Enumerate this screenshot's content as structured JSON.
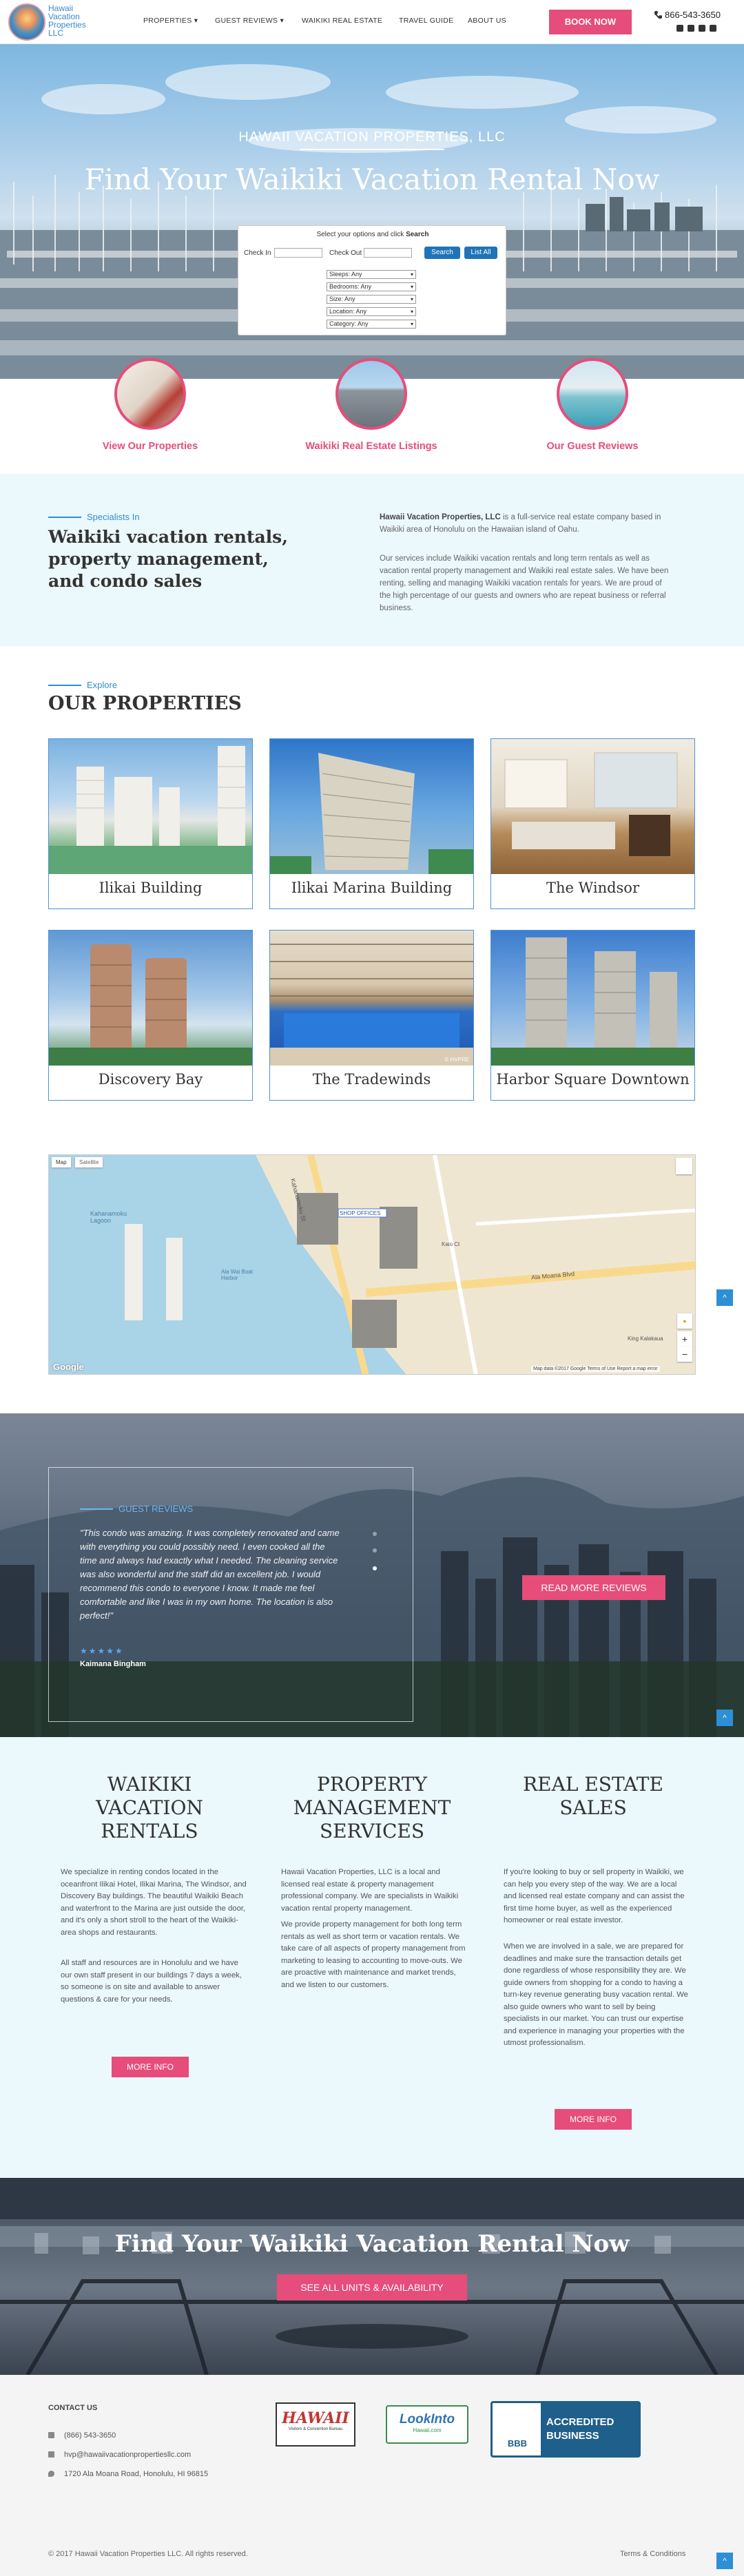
{
  "header": {
    "logo_text": "Hawaii Vacation Properties LLC",
    "nav": [
      "PROPERTIES",
      "GUEST REVIEWS",
      "WAIKIKI REAL ESTATE",
      "TRAVEL GUIDE",
      "ABOUT US"
    ],
    "book_label": "BOOK NOW",
    "phone": "866-543-3650",
    "accent_color": "#e64d7a",
    "brand_color": "#3b87c8"
  },
  "hero": {
    "subtitle": "HAWAII VACATION PROPERTIES, LLC",
    "title": "Find Your Waikiki Vacation Rental Now",
    "search": {
      "prompt": "Select your options and click ",
      "prompt_bold": "Search",
      "check_in_label": "Check In",
      "check_out_label": "Check Out",
      "search_button": "Search",
      "list_all_button": "List All",
      "selects": [
        "Sleeps: Any",
        "Bedrooms: Any",
        "Size: Any",
        "Location: Any",
        "Category: Any"
      ]
    }
  },
  "features": [
    {
      "label": "View Our Properties"
    },
    {
      "label": "Waikiki Real Estate Listings"
    },
    {
      "label": "Our Guest Reviews"
    }
  ],
  "specialists": {
    "eyebrow": "Specialists In",
    "heading": "Waikiki vacation rentals, property management, and condo sales",
    "p1_bold": "Hawaii Vacation Properties, LLC",
    "p1_rest": " is a full-service real estate company based in Waikiki area of Honolulu on the Hawaiian island of Oahu.",
    "p2": "Our services include Waikiki vacation rentals and long term rentals as well as vacation rental property management and Waikiki real estate sales. We have been renting, selling and managing Waikiki vacation rentals for years. We are proud of the high percentage of our guests and owners who are repeat business or referral business."
  },
  "properties": {
    "eyebrow": "Explore",
    "heading": "OUR PROPERTIES",
    "items": [
      {
        "name": "Ilikai Building"
      },
      {
        "name": "Ilikai Marina Building"
      },
      {
        "name": "The Windsor"
      },
      {
        "name": "Discovery Bay"
      },
      {
        "name": "The Tradewinds"
      },
      {
        "name": "Harbor Square Downtown"
      }
    ],
    "photo_credit": "© HVPRE"
  },
  "map": {
    "map_tab": "Map",
    "satellite_tab": "Satellite",
    "labels": [
      "Kahanamoku Lagoon",
      "Ala Wai Boat Harbor",
      "Ala Moana Blvd",
      "Kahanamoku St",
      "King Kalakaua",
      "Kaio Ct",
      "SHOP OFFICES"
    ],
    "google": "Google",
    "footer": "Map data ©2017 Google   Terms of Use   Report a map error"
  },
  "reviews": {
    "eyebrow": "GUEST REVIEWS",
    "quote": "\"This condo was amazing. It was completely renovated and came with everything you could possibly need. I even cooked all the time and always had exactly what I needed. The cleaning service was also wonderful and the staff did an excellent job. I would recommend this condo to everyone I know. It made me feel comfortable and like I was in my own home. The location is also perfect!\"",
    "stars": "★★★★★",
    "author": "Kaimana Bingham",
    "button": "READ MORE REVIEWS"
  },
  "services": [
    {
      "title": "WAIKIKI VACATION RENTALS",
      "paragraphs": [
        "We specialize in renting condos located in the oceanfront Ilikai Hotel, Ilikai Marina, The Windsor, and Discovery Bay buildings. The beautiful Waikiki Beach and waterfront to the Marina are just outside the door, and it's only a short stroll to the heart of the Waikiki-area shops and restaurants.",
        "All staff and resources are in Honolulu and we have our own staff present in our buildings 7 days a week, so someone is on site and available to answer questions & care for your needs."
      ],
      "button": "MORE INFO"
    },
    {
      "title": "PROPERTY MANAGEMENT SERVICES",
      "paragraphs": [
        "Hawaii Vacation Properties, LLC is a local and licensed real estate & property management professional company. We are specialists in Waikiki vacation rental property management.",
        "We provide property management for both long term rentals as well as short term or vacation rentals. We take care of all aspects of property management from marketing to leasing to accounting to move-outs. We are proactive with maintenance and market trends, and we listen to our customers."
      ],
      "button": ""
    },
    {
      "title": "REAL ESTATE SALES",
      "paragraphs": [
        "If you're looking to buy or sell property in Waikiki, we can help you every step of the way. We are a local and licensed real estate company and can assist the first time home buyer, as well as the experienced homeowner or real estate investor.",
        "When we are involved in a sale, we are prepared for deadlines and make sure the transaction details get done regardless of whose responsibility they are. We guide owners from shopping for a condo to having a turn-key revenue generating busy vacation rental. We also guide owners who want to sell by being specialists in our market. You can trust our expertise and experience in managing your properties with the utmost professionalism."
      ],
      "button": "MORE INFO"
    }
  ],
  "cta": {
    "title": "Find Your Waikiki Vacation Rental Now",
    "button": "SEE ALL UNITS & AVAILABILITY"
  },
  "footer": {
    "contact_heading": "CONTACT US",
    "phone": "(866) 543-3650",
    "email": "hvp@hawaiivacationpropertiesllc.com",
    "address": "1720 Ala Moana Road, Honolulu, HI 96815",
    "badge1": "HAWAII",
    "badge1_sub": "Visitors & Convention Bureau",
    "badge2": "LookInto",
    "badge2_sub": "Hawaii.com",
    "bbb": "BBB",
    "bbb_text": "ACCREDITED BUSINESS",
    "copyright": "© 2017 Hawaii Vacation Properties LLC. All rights reserved.",
    "terms": "Terms & Conditions"
  }
}
